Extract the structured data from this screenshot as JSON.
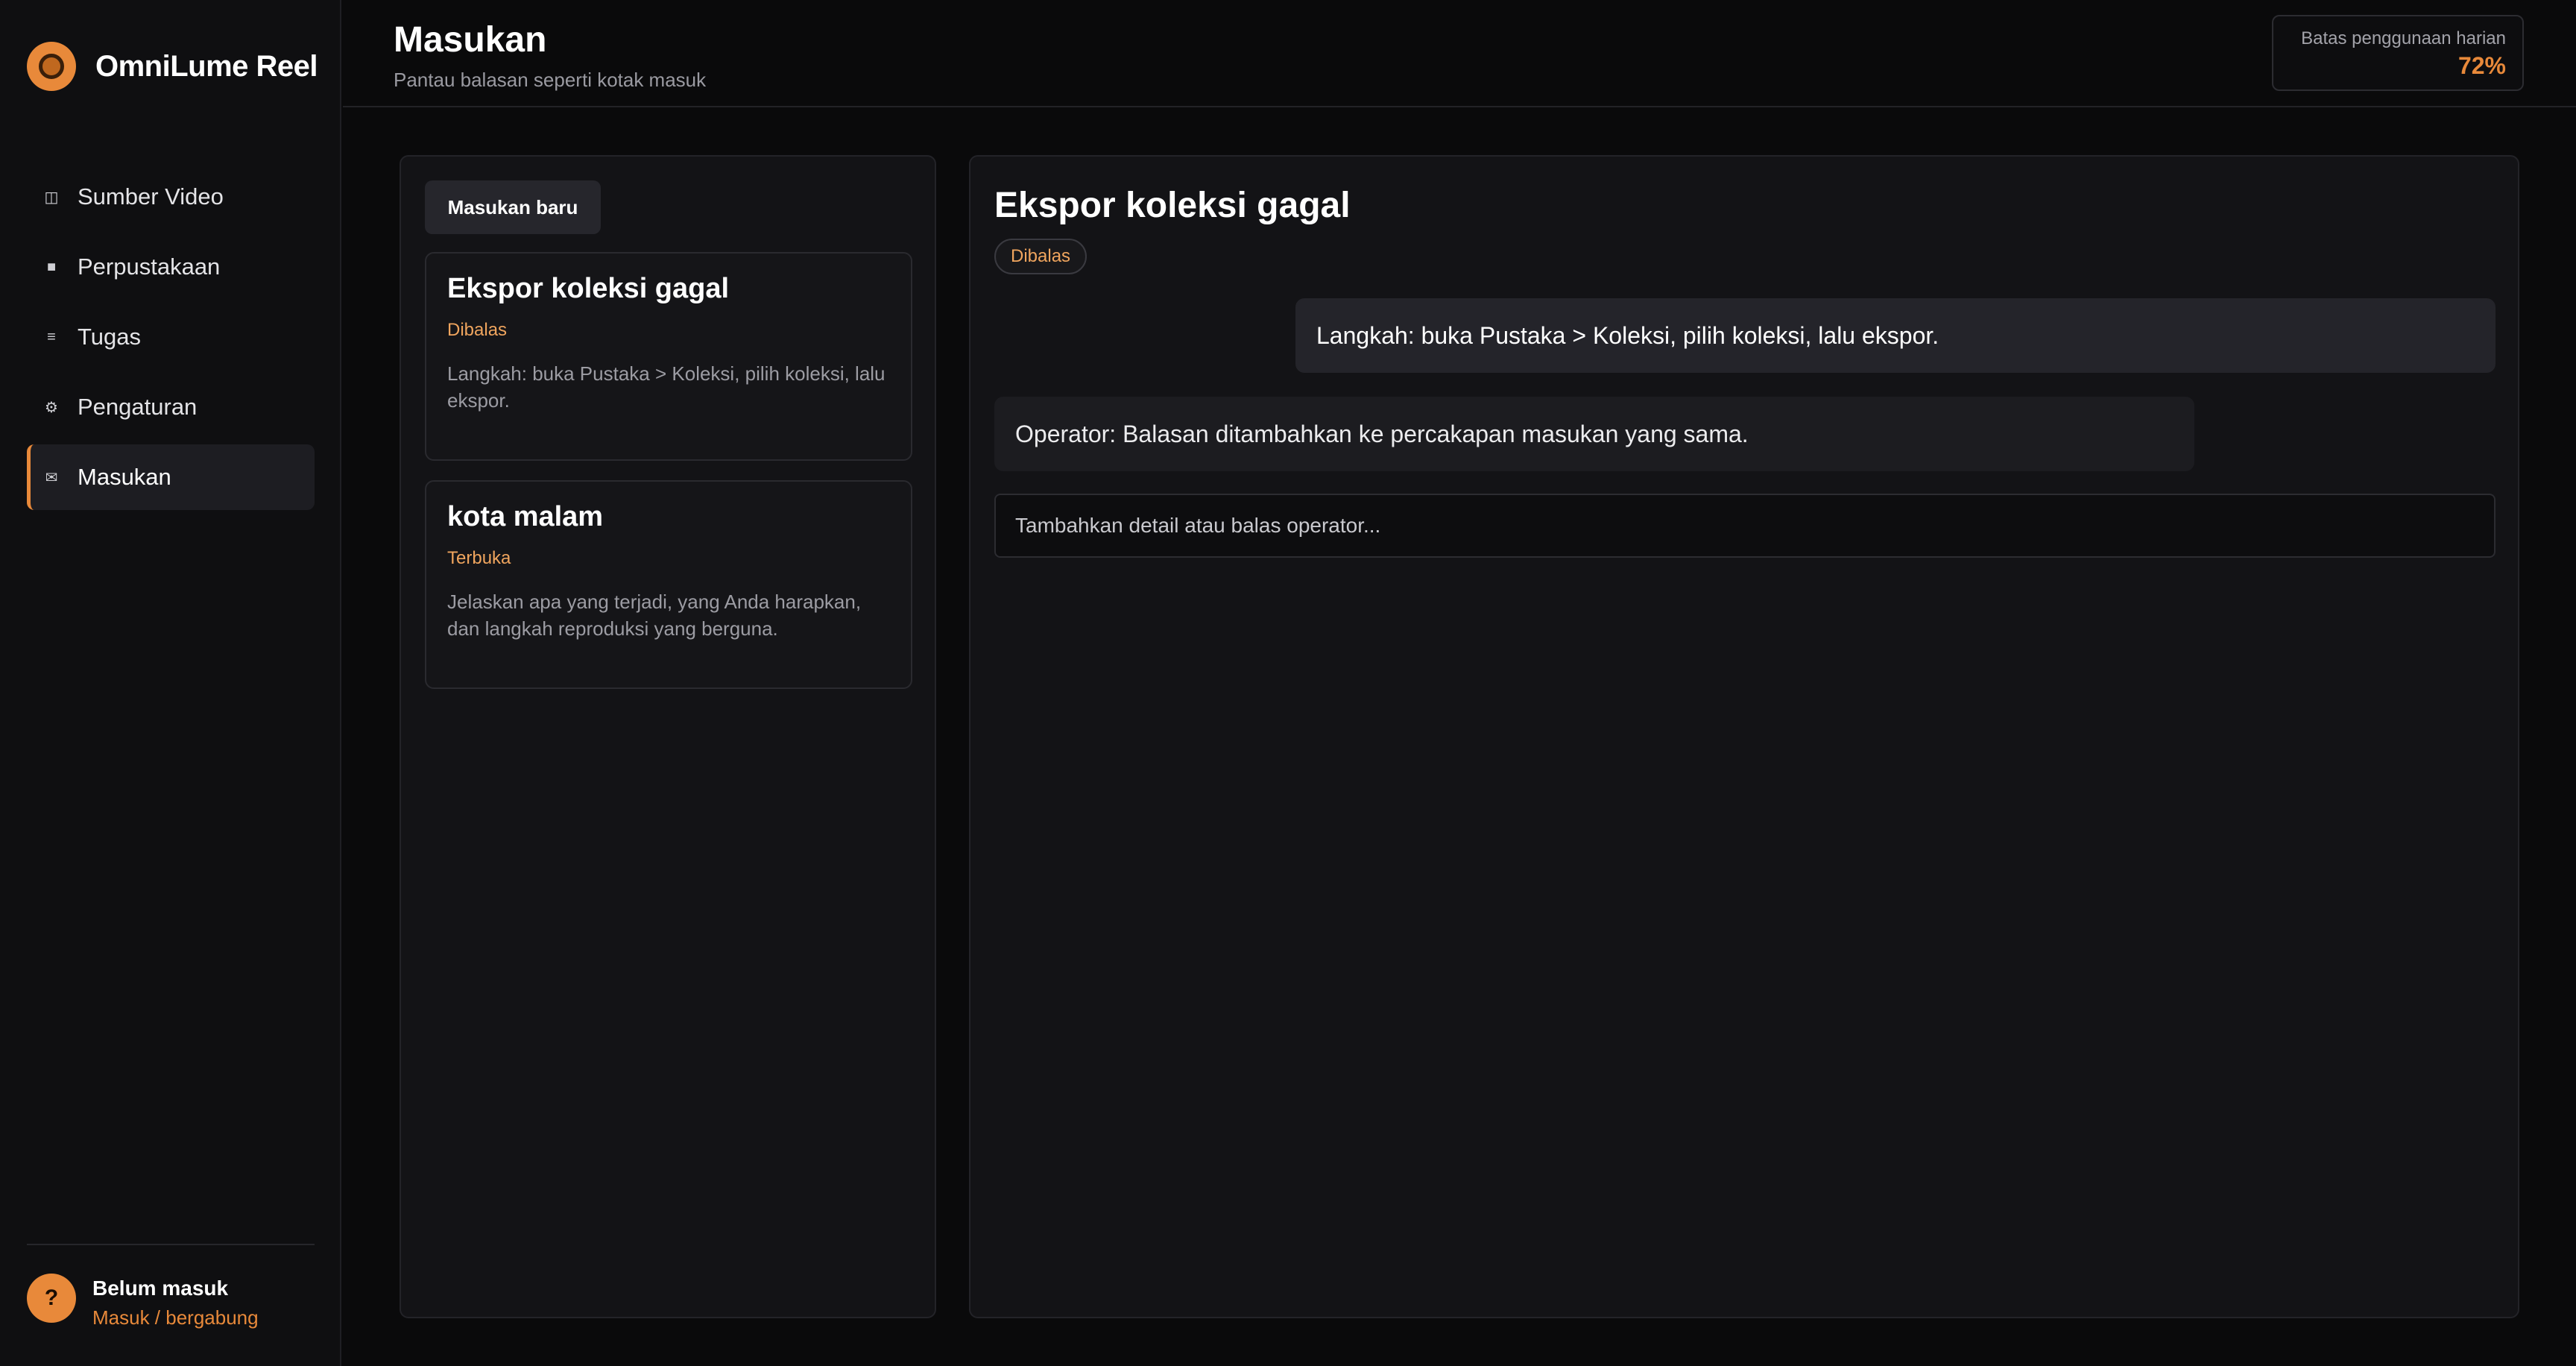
{
  "app": {
    "name": "OmniLume Reel",
    "accent": "#e8893a",
    "logo_icon": "film-reel-icon"
  },
  "sidebar": {
    "items": [
      {
        "icon": "◫",
        "icon_name": "video-source-icon",
        "label": "Sumber Video",
        "active": false
      },
      {
        "icon": "■",
        "icon_name": "library-icon",
        "label": "Perpustakaan",
        "active": false
      },
      {
        "icon": "≡",
        "icon_name": "tasks-icon",
        "label": "Tugas",
        "active": false
      },
      {
        "icon": "⚙",
        "icon_name": "gear-icon",
        "label": "Pengaturan",
        "active": false
      },
      {
        "icon": "✉",
        "icon_name": "mail-icon",
        "label": "Masukan",
        "active": true
      }
    ],
    "user": {
      "avatar": "?",
      "name": "Belum masuk",
      "link": "Masuk / bergabung"
    }
  },
  "header": {
    "title": "Masukan",
    "subtitle": "Pantau balasan seperti kotak masuk",
    "usage_label": "Batas penggunaan harian",
    "usage_value": "72%"
  },
  "list": {
    "new_button": "Masukan baru",
    "tickets": [
      {
        "title": "Ekspor koleksi gagal",
        "status": "Dibalas",
        "body": "Langkah: buka Pustaka > Koleksi, pilih koleksi, lalu ekspor."
      },
      {
        "title": "kota malam",
        "status": "Terbuka",
        "body": "Jelaskan apa yang terjadi, yang Anda harapkan, dan langkah reproduksi yang berguna."
      }
    ]
  },
  "detail": {
    "title": "Ekspor koleksi gagal",
    "status": "Dibalas",
    "messages": [
      {
        "from": "user",
        "text": "Langkah: buka Pustaka > Koleksi, pilih koleksi, lalu ekspor."
      },
      {
        "from": "operator",
        "text": "Operator: Balasan ditambahkan ke percakapan masukan yang sama."
      }
    ],
    "reply_placeholder": "Tambahkan detail atau balas operator..."
  }
}
